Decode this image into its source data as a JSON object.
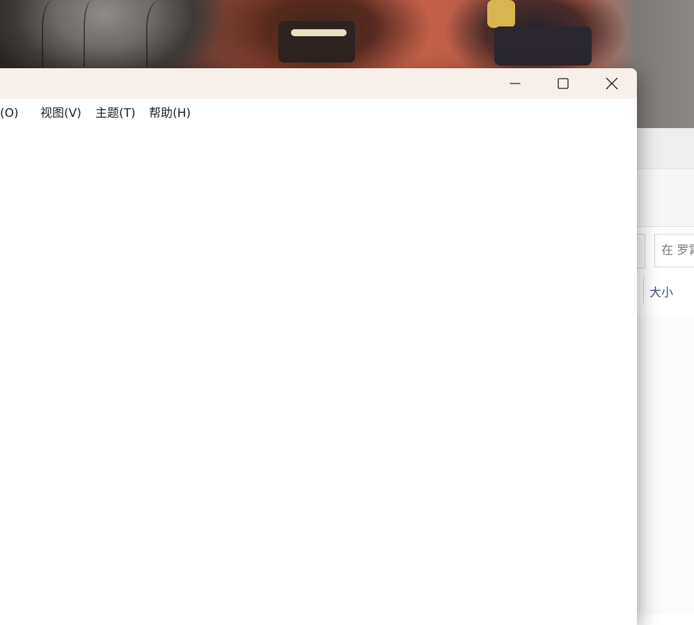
{
  "main_window": {
    "menu": [
      {
        "label": "式(O)"
      },
      {
        "label": "视图(V)"
      },
      {
        "label": "主题(T)"
      },
      {
        "label": "帮助(H)"
      }
    ],
    "caption_buttons": [
      "minimize-icon",
      "maximize-icon",
      "close-icon"
    ],
    "editor_text": ""
  },
  "background_window": {
    "search_placeholder": "在 罗霄",
    "column_size_label": "大小"
  },
  "colors": {
    "titlebar": "#f7efea",
    "menu_text": "#1f1f1f",
    "column_header_text": "#3c4f78"
  }
}
